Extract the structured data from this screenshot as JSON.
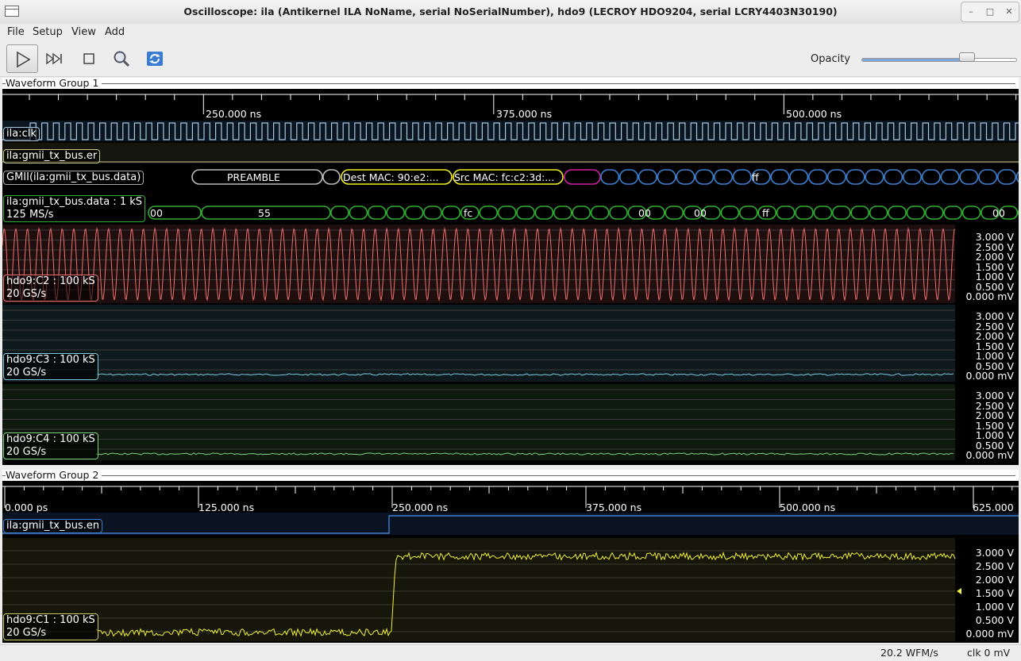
{
  "window": {
    "title": "Oscilloscope: ila (Antikernel ILA NoName, serial NoSerialNumber), hdo9 (LECROY HDO9204, serial LCRY4403N30190)"
  },
  "menu": {
    "items": [
      "File",
      "Setup",
      "View",
      "Add"
    ]
  },
  "toolbar": {
    "buttons": [
      "start-trigger",
      "single-trigger",
      "stop-trigger",
      "zoom-fit",
      "refresh"
    ],
    "opacity_label": "Opacity",
    "opacity_value": 0.68
  },
  "group1": {
    "title": "Waveform Group 1",
    "ruler_labels": [
      "250.000 ns",
      "375.000 ns",
      "500.000 ns"
    ],
    "channels": {
      "clk": "ila:clk",
      "er": "ila:gmii_tx_bus.er",
      "gmii": "GMII(ila:gmii_tx_bus.data)",
      "data_line1": "ila:gmii_tx_bus.data : 1 kS",
      "data_line2": "125 MS/s",
      "c2_line1": "hdo9:C2 : 100 kS",
      "c2_line2": "20 GS/s",
      "c3_line1": "hdo9:C3 : 100 kS",
      "c3_line2": "20 GS/s",
      "c4_line1": "hdo9:C4 : 100 kS",
      "c4_line2": "20 GS/s"
    },
    "protocol": {
      "preamble": "PREAMBLE",
      "dest": "Dest MAC: 90:e2:...",
      "src": "Src MAC: fc:c2:3d:...",
      "ff": "ff"
    },
    "data_bytes": {
      "b00a": "00",
      "b55": "55",
      "bfc": "fc",
      "b00b": "00",
      "b00c": "00",
      "bff": "ff",
      "b00d": "00"
    },
    "scale": [
      "3.000 V",
      "2.500 V",
      "2.000 V",
      "1.500 V",
      "1.000 V",
      "0.500 V",
      "0.000 mV"
    ]
  },
  "group2": {
    "title": "Waveform Group 2",
    "ruler_labels": [
      "0.000 ps",
      "125.000 ns",
      "250.000 ns",
      "375.000 ns",
      "500.000 ns",
      "625.000"
    ],
    "channels": {
      "en": "ila:gmii_tx_bus.en",
      "c1_line1": "hdo9:C1 : 100 kS",
      "c1_line2": "20 GS/s"
    },
    "scale": [
      "3.000 V",
      "2.500 V",
      "2.000 V",
      "1.500 V",
      "1.000 V",
      "0.500 V",
      "0.000 mV"
    ]
  },
  "status": {
    "wfm_rate": "20.2 WFM/s",
    "cursor": "clk 0 mV"
  },
  "colors": {
    "clk": "#a8c8e0",
    "er": "#c8c88a",
    "preamble": "#bbbbbb",
    "mac": "#f0f020",
    "payload": "#3f7fd0",
    "data": "#30b030",
    "c2": "#f07070",
    "c3": "#7fc8d8",
    "c4": "#7fd07f",
    "en": "#3f7fd0",
    "c1": "#f0f040"
  }
}
